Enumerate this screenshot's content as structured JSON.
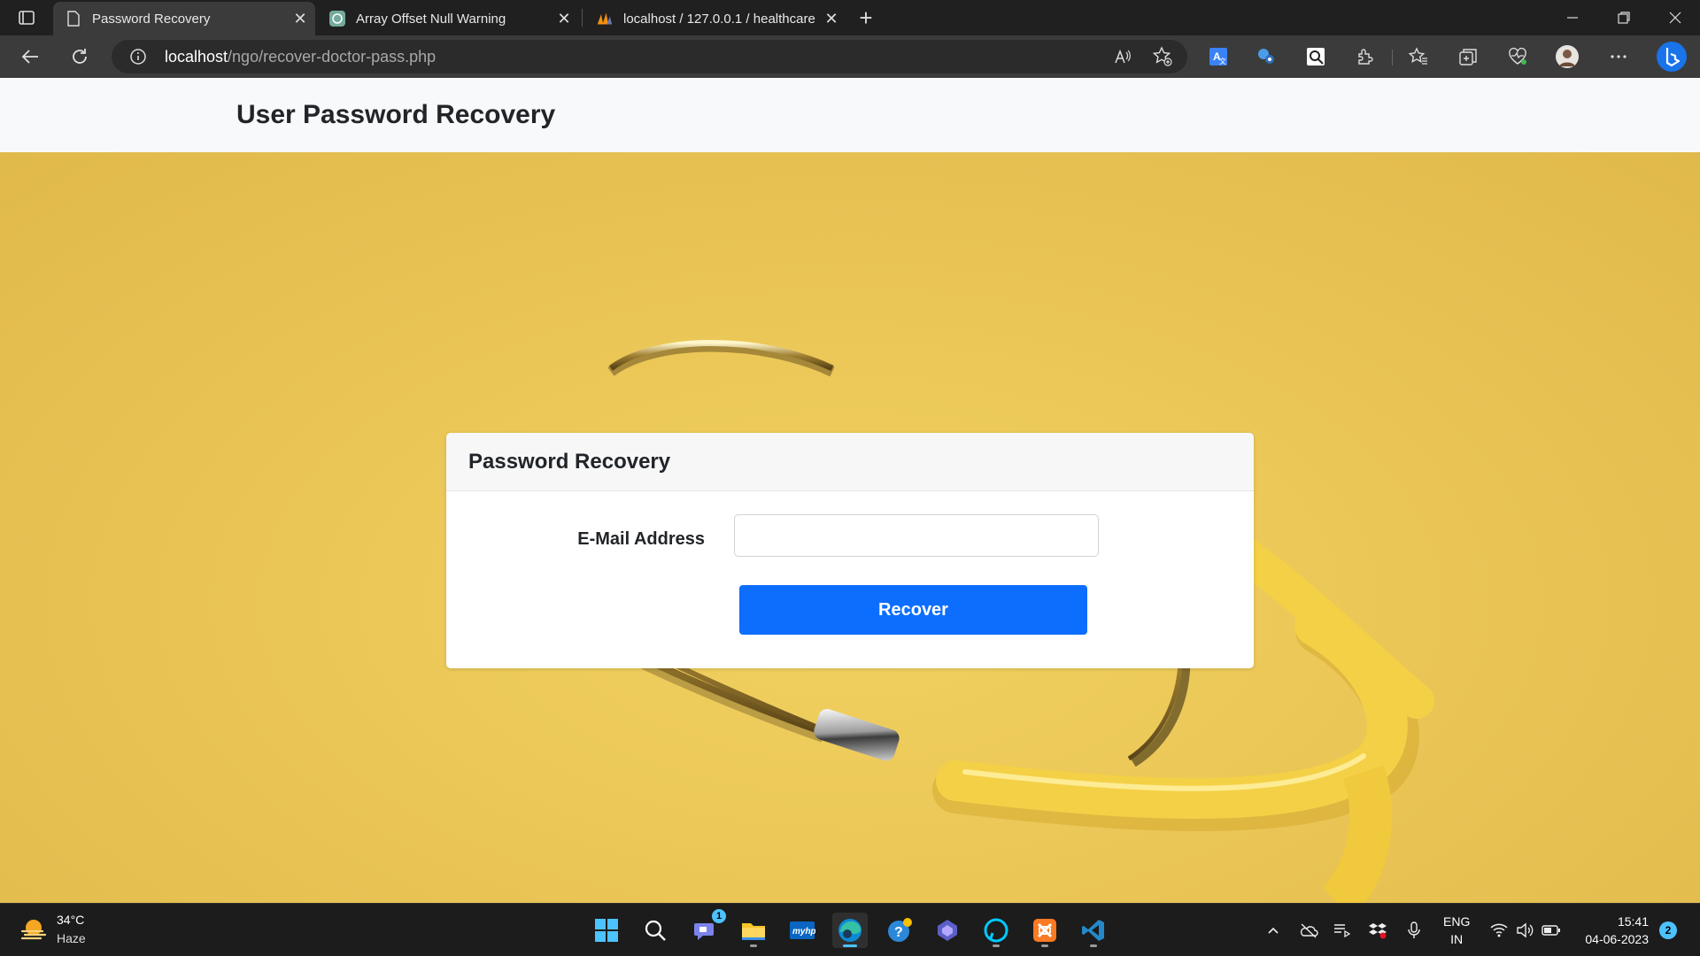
{
  "browser": {
    "tabs": [
      {
        "title": "Password Recovery",
        "icon": "page-icon",
        "active": true
      },
      {
        "title": "Array Offset Null Warning",
        "icon": "chatgpt-icon",
        "active": false
      },
      {
        "title": "localhost / 127.0.0.1 / healthcare",
        "icon": "phpmyadmin-icon",
        "active": false
      }
    ],
    "url_host": "localhost",
    "url_path": "/ngo/recover-doctor-pass.php"
  },
  "page": {
    "header_title": "User Password Recovery",
    "card_title": "Password Recovery",
    "email_label": "E-Mail Address",
    "email_value": "",
    "recover_label": "Recover"
  },
  "taskbar": {
    "weather_temp": "34°C",
    "weather_desc": "Haze",
    "chat_badge": "1",
    "lang_1": "ENG",
    "lang_2": "IN",
    "time": "15:41",
    "date": "04-06-2023",
    "notifications": "2"
  },
  "colors": {
    "accent": "#0d6efd",
    "hero_background": "#e9c455",
    "taskbar_accent": "#4cc2ff"
  }
}
